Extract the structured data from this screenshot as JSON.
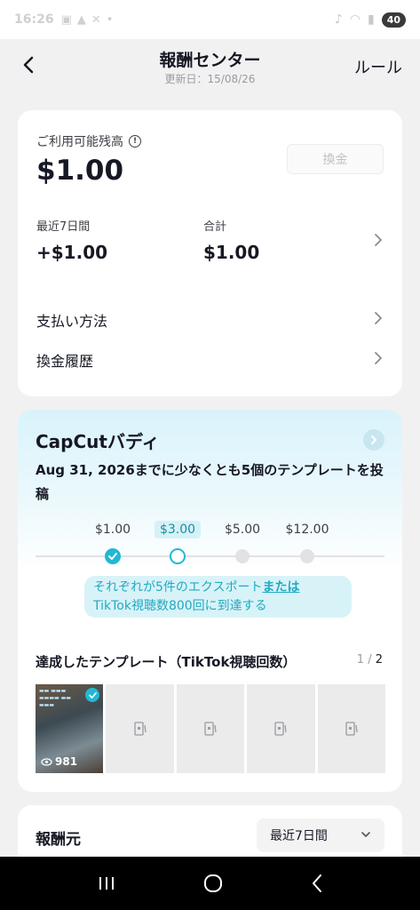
{
  "status_bar": {
    "time": "16:26",
    "battery": "40"
  },
  "header": {
    "title": "報酬センター",
    "updated": "更新日：15/08/26",
    "rules": "ルール"
  },
  "balance": {
    "label": "ご利用可能残高",
    "amount": "$1.00",
    "withdraw_label": "換金",
    "last7_label": "最近7日間",
    "last7_value": "+$1.00",
    "total_label": "合計",
    "total_value": "$1.00",
    "payment_method": "支払い方法",
    "withdraw_history": "換金履歴"
  },
  "buddy": {
    "title": "CapCutバディ",
    "description": "Aug 31, 2026までに少なくとも5個のテンプレートを投稿",
    "milestones": [
      "$1.00",
      "$3.00",
      "$5.00",
      "$12.00"
    ],
    "hint_part1": "それぞれが5件のエクスポート",
    "hint_or": "または",
    "hint_part2": "TikTok視聴数800回に到達する",
    "achieved_title": "達成したテンプレート（TikTok視聴回数）",
    "pager_current": "1",
    "pager_sep": "/",
    "pager_total": "2",
    "first_views": "981"
  },
  "source": {
    "title": "報酬元",
    "period": "最近7日間"
  },
  "colors": {
    "accent": "#22b8d3",
    "background": "#f1f1f2",
    "text": "#161823"
  }
}
